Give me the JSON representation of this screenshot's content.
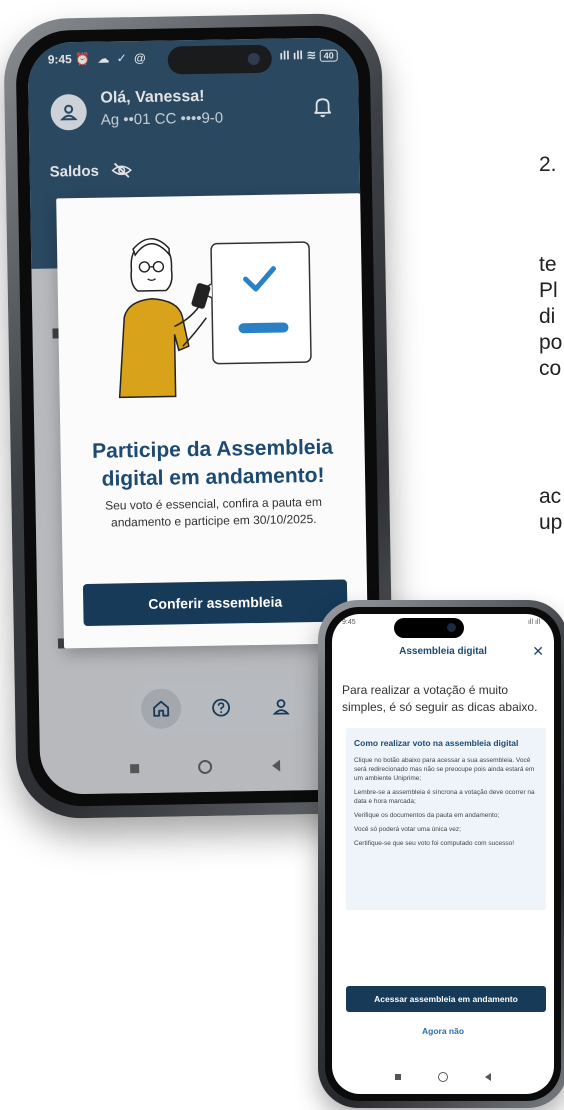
{
  "background_slide": {
    "number": "2.",
    "lines": [
      "te",
      "Pl",
      "di",
      "po",
      "co"
    ],
    "lines2": [
      "ac",
      "up"
    ]
  },
  "phone1": {
    "status": {
      "time": "9:45",
      "icons": "⏰ ☁ ✓ @",
      "signal": "ıll ıll",
      "battery": "40"
    },
    "greeting": "Olá, Vanessa!",
    "account": "Ag ••01 CC ••••9-0",
    "saldos_label": "Saldos",
    "modal": {
      "title": "Participe da Assembleia digital em andamento!",
      "body": "Seu voto é essencial, confira a pauta em andamento e participe em 30/10/2025.",
      "button": "Conferir assembleia"
    },
    "nav_icons": [
      "home-icon",
      "help-icon",
      "profile-icon"
    ]
  },
  "phone2": {
    "status": {
      "time": "9:45",
      "right": "ıll ıll"
    },
    "title": "Assembleia digital",
    "intro": "Para realizar a votação é muito simples, é só seguir as dicas abaixo.",
    "tips_title": "Como realizar voto na assembleia digital",
    "tips": [
      "Clique no botão abaixo para acessar a sua assembleia. Você será redirecionado mas não se preocupe pois ainda estará em um ambiente Uniprime;",
      "Lembre-se a assembleia é síncrona a votação deve ocorrer na data e hora marcada;",
      "Verifique os documentos da pauta em andamento;",
      "Você só poderá votar uma única vez;",
      "Certifique-se que seu voto foi computado com sucesso!"
    ],
    "primary_button": "Acessar assembleia em andamento",
    "secondary_link": "Agora não"
  },
  "colors": {
    "brand_dark": "#163a58",
    "title_blue": "#1d4a73",
    "link_blue": "#2a6fb0",
    "tips_bg": "#eef4fa",
    "illustration_yellow": "#d9a21b"
  }
}
